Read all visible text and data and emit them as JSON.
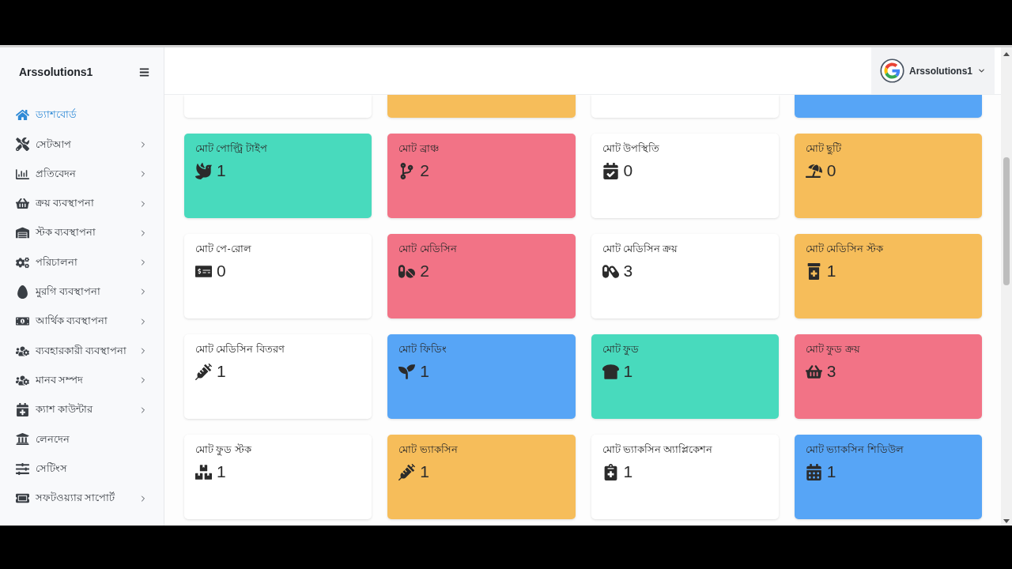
{
  "sidebar": {
    "brand": "Arssolutions1",
    "items": [
      {
        "label": "ড্যাশবোর্ড",
        "selected": true,
        "has_submenu": false
      },
      {
        "label": "সেটআপ",
        "selected": false,
        "has_submenu": true
      },
      {
        "label": "প্রতিবেদন",
        "selected": false,
        "has_submenu": true
      },
      {
        "label": "ক্রয় ব্যবস্থাপনা",
        "selected": false,
        "has_submenu": true
      },
      {
        "label": "স্টক ব্যবস্থাপনা",
        "selected": false,
        "has_submenu": true
      },
      {
        "label": "পরিচালনা",
        "selected": false,
        "has_submenu": true
      },
      {
        "label": "মুরগি ব্যবস্থাপনা",
        "selected": false,
        "has_submenu": true
      },
      {
        "label": "আর্থিক ব্যবস্থাপনা",
        "selected": false,
        "has_submenu": true
      },
      {
        "label": "ব্যবহারকারী ব্যবস্থাপনা",
        "selected": false,
        "has_submenu": true
      },
      {
        "label": "মানব সম্পদ",
        "selected": false,
        "has_submenu": true
      },
      {
        "label": "ক্যাশ কাউন্টার",
        "selected": false,
        "has_submenu": true
      },
      {
        "label": "লেনদেন",
        "selected": false,
        "has_submenu": false
      },
      {
        "label": "সেটিংস",
        "selected": false,
        "has_submenu": false
      },
      {
        "label": "সফটওয়্যার সাপোর্ট",
        "selected": false,
        "has_submenu": true
      }
    ]
  },
  "header": {
    "user": {
      "name": "Arssolutions1"
    }
  },
  "cards": [
    {
      "color": "#ffffff"
    },
    {
      "color": "#f6bd5a"
    },
    {
      "color": "#ffffff"
    },
    {
      "color": "#57a5f6"
    },
    {
      "title": "মোট পোল্ট্রি টাইপ",
      "value": "1",
      "color": "#48dabd"
    },
    {
      "title": "মোট ব্রাঞ্চ",
      "value": "2",
      "color": "#f27386"
    },
    {
      "title": "মোট উপস্থিতি",
      "value": "0",
      "color": "#ffffff"
    },
    {
      "title": "মোট ছুটি",
      "value": "0",
      "color": "#f6bd5a"
    },
    {
      "title": "মোট পে-রোল",
      "value": "0",
      "color": "#ffffff"
    },
    {
      "title": "মোট মেডিসিন",
      "value": "2",
      "color": "#f27386"
    },
    {
      "title": "মোট মেডিসিন ক্রয়",
      "value": "3",
      "color": "#ffffff"
    },
    {
      "title": "মোট মেডিসিন স্টক",
      "value": "1",
      "color": "#f6bd5a"
    },
    {
      "title": "মোট মেডিসিন বিতরণ",
      "value": "1",
      "color": "#ffffff"
    },
    {
      "title": "মোট ফিডিং",
      "value": "1",
      "color": "#57a5f6"
    },
    {
      "title": "মোট ফুড",
      "value": "1",
      "color": "#48dabd"
    },
    {
      "title": "মোট ফুড ক্রয়",
      "value": "3",
      "color": "#f27386"
    },
    {
      "title": "মোট ফুড স্টক",
      "value": "1",
      "color": "#ffffff"
    },
    {
      "title": "মোট ভ্যাকসিন",
      "value": "1",
      "color": "#f6bd5a"
    },
    {
      "title": "মোট ভ্যাকসিন অ্যাপ্লিকেশন",
      "value": "1",
      "color": "#ffffff"
    },
    {
      "title": "মোট ভ্যাকসিন শিডিউল",
      "value": "1",
      "color": "#57a5f6"
    }
  ]
}
